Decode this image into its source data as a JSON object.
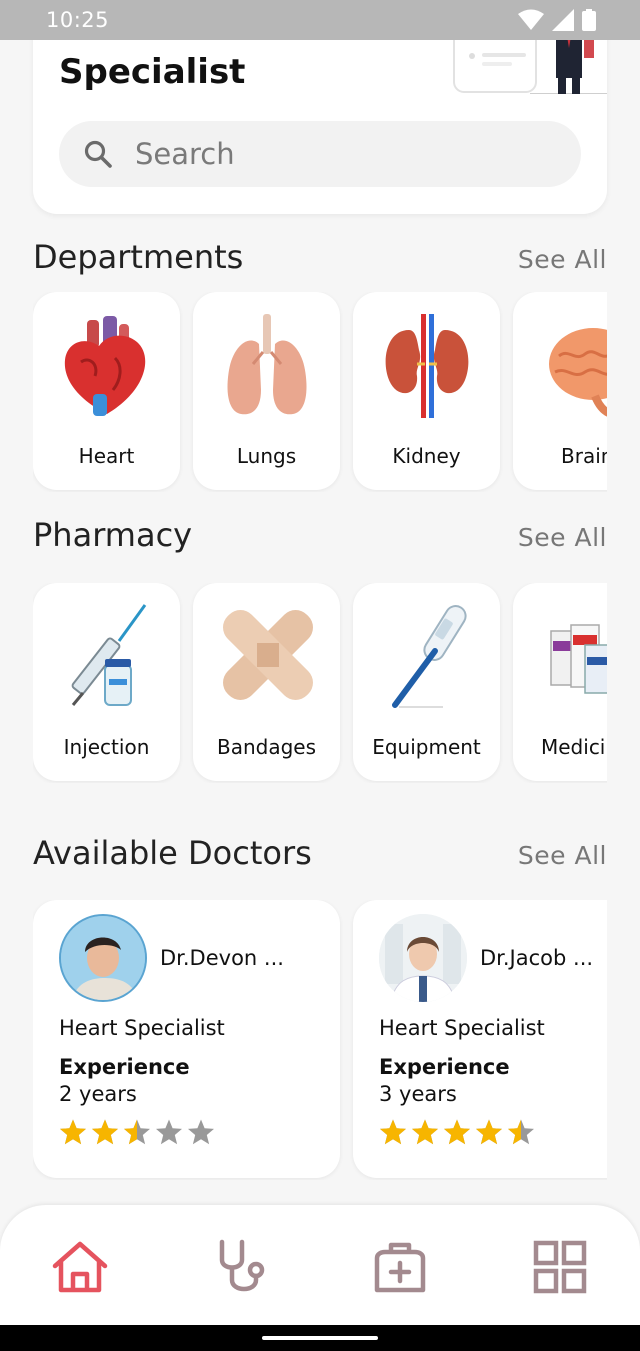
{
  "status": {
    "time": "10:25"
  },
  "hero": {
    "title": "Specialist"
  },
  "search": {
    "placeholder": "Search"
  },
  "departments": {
    "title": "Departments",
    "see_all": "See All",
    "items": [
      {
        "label": "Heart",
        "icon": "heart-organ-icon"
      },
      {
        "label": "Lungs",
        "icon": "lungs-icon"
      },
      {
        "label": "Kidney",
        "icon": "kidney-icon"
      },
      {
        "label": "Brain",
        "icon": "brain-icon"
      }
    ]
  },
  "pharmacy": {
    "title": "Pharmacy",
    "see_all": "See All",
    "items": [
      {
        "label": "Injection",
        "icon": "syringe-icon"
      },
      {
        "label": "Bandages",
        "icon": "bandage-icon"
      },
      {
        "label": "Equipment",
        "icon": "thermometer-icon"
      },
      {
        "label": "Medicine",
        "icon": "medicine-boxes-icon"
      }
    ]
  },
  "doctors": {
    "title": "Available Doctors",
    "see_all": "See All",
    "experience_label": "Experience",
    "items": [
      {
        "name": "Dr.Devon ...",
        "specialty": "Heart Specialist",
        "experience": "2 years",
        "rating": 2.5
      },
      {
        "name": "Dr.Jacob ...",
        "specialty": "Heart Specialist",
        "experience": "3 years",
        "rating": 4.5
      }
    ]
  },
  "bottom_nav": {
    "items": [
      {
        "icon": "home-icon",
        "active": true
      },
      {
        "icon": "stethoscope-icon",
        "active": false
      },
      {
        "icon": "medical-kit-icon",
        "active": false
      },
      {
        "icon": "grid-icon",
        "active": false
      }
    ]
  },
  "colors": {
    "active": "#e5535e",
    "inactive": "#a38a8f",
    "star": "#f7b500",
    "star_empty": "#999999"
  }
}
